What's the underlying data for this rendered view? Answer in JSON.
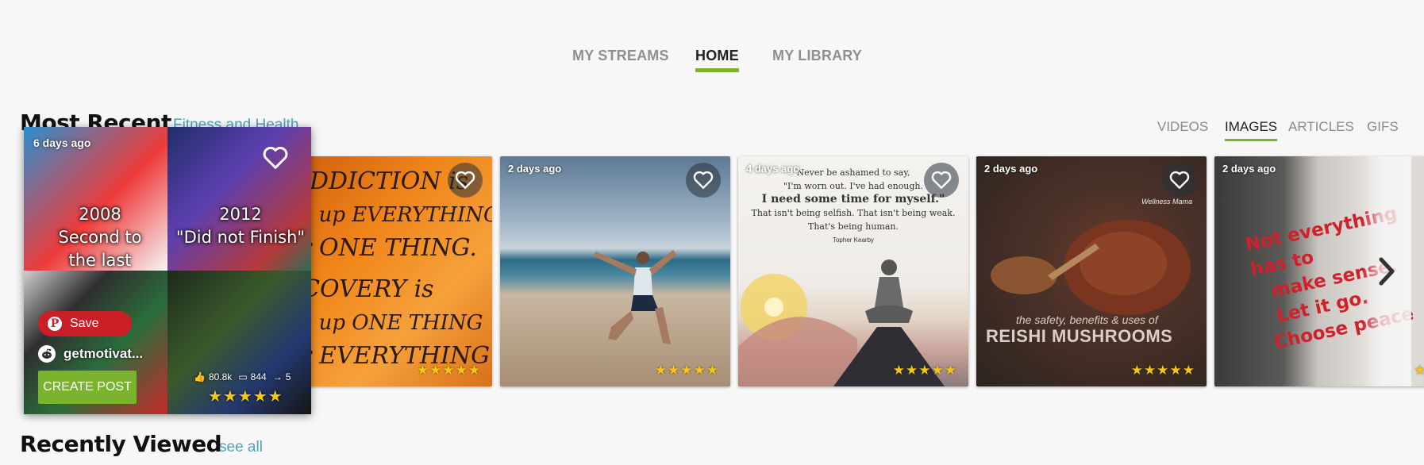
{
  "nav": {
    "tabs": [
      {
        "label": "MY STREAMS",
        "active": false
      },
      {
        "label": "HOME",
        "active": true
      },
      {
        "label": "MY LIBRARY",
        "active": false
      }
    ]
  },
  "most_recent": {
    "title": "Most Recent",
    "topic_link": "Fitness and Health",
    "filters": [
      {
        "label": "VIDEOS",
        "active": false
      },
      {
        "label": "IMAGES",
        "active": true
      },
      {
        "label": "ARTICLES",
        "active": false
      },
      {
        "label": "GIFS",
        "active": false
      }
    ],
    "hovered_card": {
      "age": "6 days ago",
      "caption_left": "2008\nSecond to\nthe last",
      "caption_right": "2012\n\"Did not Finish\"",
      "save_label": "Save",
      "source_name": "getmotivat...",
      "create_post_label": "CREATE POST",
      "likes": "80.8k",
      "comments": "844",
      "shares": "5",
      "rating": 5,
      "stars": "★★★★★"
    },
    "cards": [
      {
        "age": "",
        "rating": 5,
        "stars": "★★★★★",
        "handwriting": [
          "DDICTION is",
          "ng up EVERYTHING",
          "or ONE THING.",
          "COVERY is",
          "ng up ONE THING",
          "or EVERYTHING"
        ]
      },
      {
        "age": "2 days ago",
        "rating": 5,
        "stars": "★★★★★"
      },
      {
        "age": "4 days ago",
        "rating": 5,
        "stars": "★★★★★",
        "quote": {
          "l1": "Never be ashamed to say,",
          "l2": "\"I'm worn out. I've had enough.",
          "l3": "I need some time for myself.\"",
          "l4": "That isn't being selfish. That isn't being weak.",
          "l5": "That's being human.",
          "author": "Topher Kearby"
        }
      },
      {
        "age": "2 days ago",
        "rating": 5,
        "stars": "★★★★★",
        "overlay": {
          "small": "the safety, benefits & uses of",
          "big": "REISHI MUSHROOMS",
          "brand": "Wellness Mama"
        }
      },
      {
        "age": "2 days ago",
        "rating": 5,
        "stars": "★★★",
        "sign": [
          "Not everything has to",
          "make sense.",
          "Let it go.",
          "Choose peace"
        ]
      }
    ]
  },
  "recently_viewed": {
    "title": "Recently Viewed",
    "see_all": "see all"
  },
  "colors": {
    "accent": "#7bb32e",
    "link": "#4aa3c2",
    "star": "#f5c518",
    "pinterest": "#cb1f27"
  }
}
